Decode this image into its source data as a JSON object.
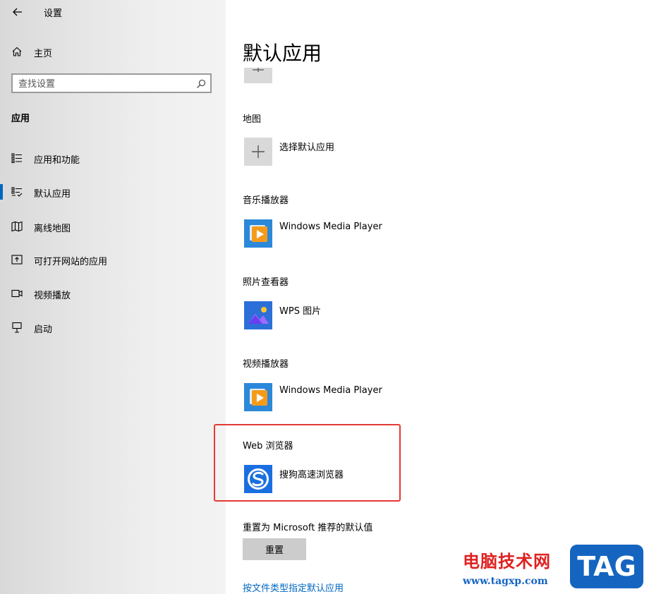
{
  "window": {
    "title": "设置"
  },
  "sidebar": {
    "home_label": "主页",
    "search_placeholder": "查找设置",
    "section_header": "应用",
    "items": [
      {
        "label": "应用和功能",
        "icon": "apps-features-icon",
        "active": false
      },
      {
        "label": "默认应用",
        "icon": "default-apps-icon",
        "active": true
      },
      {
        "label": "离线地图",
        "icon": "offline-maps-icon",
        "active": false
      },
      {
        "label": "可打开网站的应用",
        "icon": "apps-for-websites-icon",
        "active": false
      },
      {
        "label": "视频播放",
        "icon": "video-playback-icon",
        "active": false
      },
      {
        "label": "启动",
        "icon": "startup-icon",
        "active": false
      }
    ]
  },
  "main": {
    "title": "默认应用",
    "categories": [
      {
        "label": "地图",
        "app": "选择默认应用",
        "icon": "plus-icon"
      },
      {
        "label": "音乐播放器",
        "app": "Windows Media Player",
        "icon": "windows-media-player-icon"
      },
      {
        "label": "照片查看器",
        "app": "WPS 图片",
        "icon": "wps-pictures-icon"
      },
      {
        "label": "视频播放器",
        "app": "Windows Media Player",
        "icon": "windows-media-player-icon"
      },
      {
        "label": "Web 浏览器",
        "app": "搜狗高速浏览器",
        "icon": "sogou-browser-icon"
      }
    ],
    "reset_label": "重置为 Microsoft 推荐的默认值",
    "reset_button": "重置",
    "link_file_types": "按文件类型指定默认应用"
  },
  "watermark": {
    "title": "电脑技术网",
    "url": "www.tagxp.com",
    "tag": "TAG"
  },
  "colors": {
    "accent": "#0067c0",
    "highlight_border": "#e53935",
    "watermark_red": "#e02020",
    "watermark_blue": "#1565c0"
  }
}
